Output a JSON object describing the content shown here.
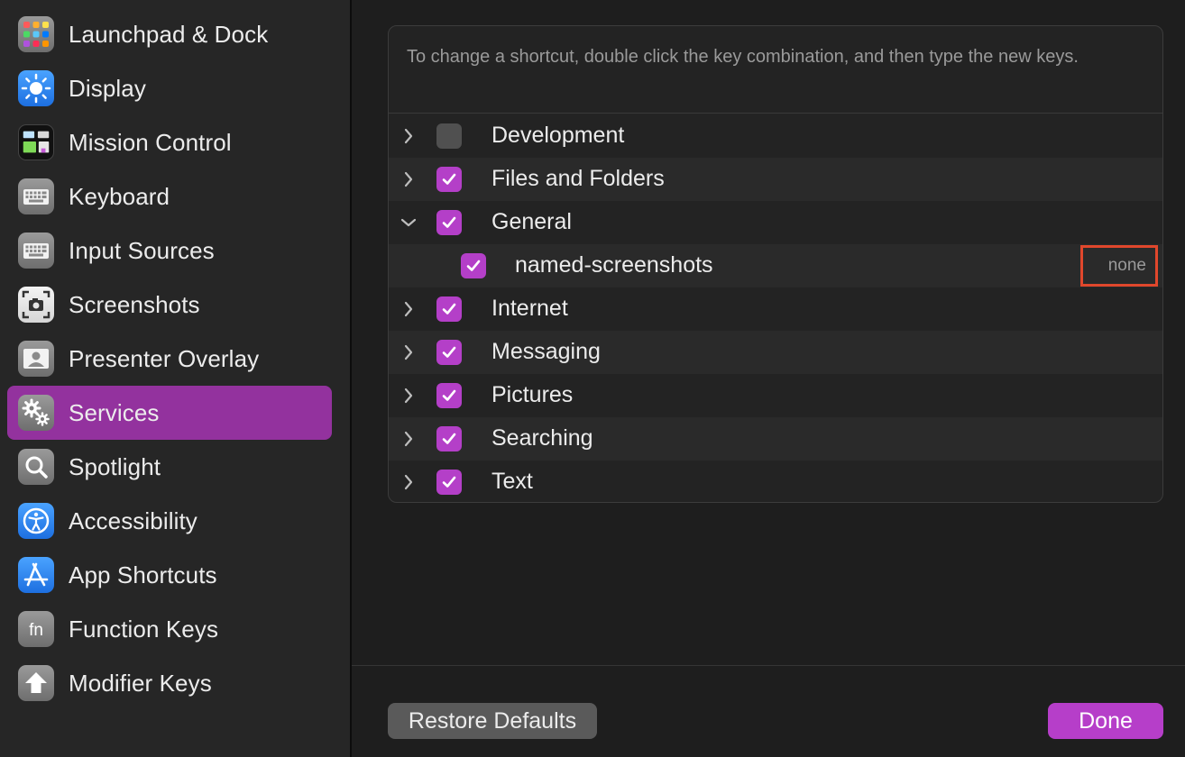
{
  "sidebar": {
    "items": [
      {
        "label": "Launchpad & Dock",
        "icon": "launchpad-icon"
      },
      {
        "label": "Display",
        "icon": "display-icon"
      },
      {
        "label": "Mission Control",
        "icon": "mission-control-icon"
      },
      {
        "label": "Keyboard",
        "icon": "keyboard-icon"
      },
      {
        "label": "Input Sources",
        "icon": "input-sources-icon"
      },
      {
        "label": "Screenshots",
        "icon": "screenshots-icon"
      },
      {
        "label": "Presenter Overlay",
        "icon": "presenter-overlay-icon"
      },
      {
        "label": "Services",
        "icon": "services-gear-icon",
        "selected": true
      },
      {
        "label": "Spotlight",
        "icon": "spotlight-icon"
      },
      {
        "label": "Accessibility",
        "icon": "accessibility-icon"
      },
      {
        "label": "App Shortcuts",
        "icon": "app-shortcuts-icon"
      },
      {
        "label": "Function Keys",
        "icon": "function-keys-icon"
      },
      {
        "label": "Modifier Keys",
        "icon": "modifier-keys-icon"
      }
    ]
  },
  "main": {
    "hint": "To change a shortcut, double click the key combination, and then type the new keys.",
    "rows": [
      {
        "label": "Development",
        "checked": false,
        "expanded": false
      },
      {
        "label": "Files and Folders",
        "checked": true,
        "expanded": false
      },
      {
        "label": "General",
        "checked": true,
        "expanded": true
      },
      {
        "label": "named-screenshots",
        "checked": true,
        "child": true,
        "shortcut": "none"
      },
      {
        "label": "Internet",
        "checked": true,
        "expanded": false
      },
      {
        "label": "Messaging",
        "checked": true,
        "expanded": false
      },
      {
        "label": "Pictures",
        "checked": true,
        "expanded": false
      },
      {
        "label": "Searching",
        "checked": true,
        "expanded": false
      },
      {
        "label": "Text",
        "checked": true,
        "expanded": false
      }
    ],
    "restore_label": "Restore Defaults",
    "done_label": "Done"
  },
  "colors": {
    "accent": "#b43fc8",
    "selected_sidebar": "#93329e",
    "highlight_box": "#e0472c"
  }
}
